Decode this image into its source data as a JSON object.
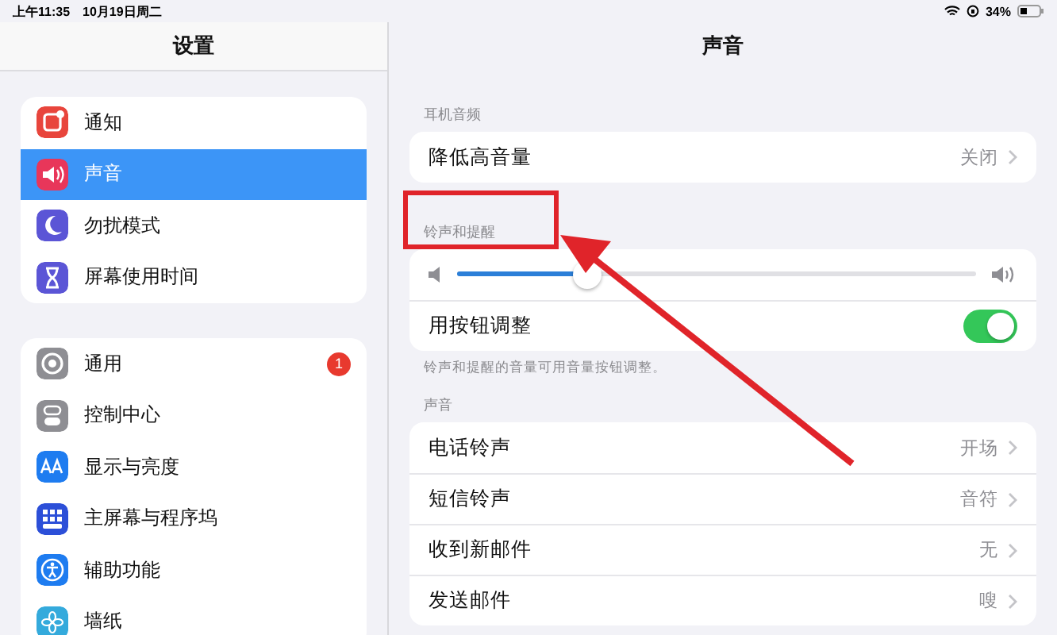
{
  "status_bar": {
    "time": "上午11:35",
    "date": "10月19日周二",
    "battery": "34%"
  },
  "sidebar": {
    "title": "设置",
    "groups": [
      {
        "items": [
          {
            "label": "通知",
            "color": "#e8453c",
            "selected": false
          },
          {
            "label": "声音",
            "color": "#e8365a",
            "selected": true
          },
          {
            "label": "勿扰模式",
            "color": "#5b55d6",
            "selected": false
          },
          {
            "label": "屏幕使用时间",
            "color": "#5b55d6",
            "selected": false
          }
        ]
      },
      {
        "items": [
          {
            "label": "通用",
            "color": "#8e8e93",
            "selected": false,
            "badge": "1"
          },
          {
            "label": "控制中心",
            "color": "#8e8e93",
            "selected": false
          },
          {
            "label": "显示与亮度",
            "color": "#1e7cf0",
            "selected": false
          },
          {
            "label": "主屏幕与程序坞",
            "color": "#2c4fd8",
            "selected": false
          },
          {
            "label": "辅助功能",
            "color": "#1e7cf0",
            "selected": false
          },
          {
            "label": "墙纸",
            "color": "#34aadc",
            "selected": false
          }
        ]
      }
    ]
  },
  "detail": {
    "title": "声音",
    "sections": [
      {
        "header": "耳机音频",
        "rows": [
          {
            "kind": "link",
            "label": "降低高音量",
            "value": "关闭"
          }
        ]
      },
      {
        "header": "铃声和提醒",
        "rows": [
          {
            "kind": "slider",
            "level": 0.25
          },
          {
            "kind": "toggle",
            "label": "用按钮调整",
            "on": true
          }
        ],
        "footer": "铃声和提醒的音量可用音量按钮调整。"
      },
      {
        "header": "声音",
        "rows": [
          {
            "kind": "link",
            "label": "电话铃声",
            "value": "开场"
          },
          {
            "kind": "link",
            "label": "短信铃声",
            "value": "音符"
          },
          {
            "kind": "link",
            "label": "收到新邮件",
            "value": "无"
          },
          {
            "kind": "link",
            "label": "发送邮件",
            "value": "嗖"
          }
        ]
      }
    ]
  }
}
